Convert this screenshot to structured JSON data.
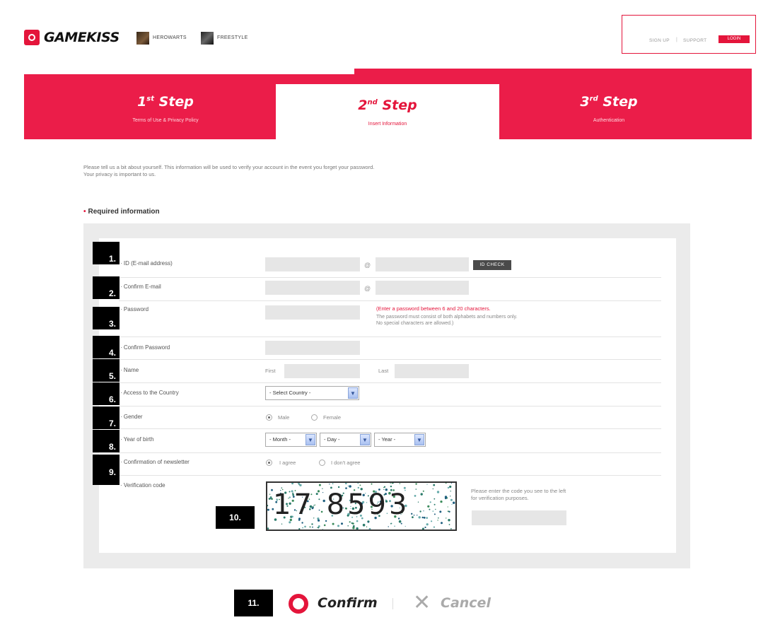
{
  "header": {
    "logo_text": "GAMEKISS",
    "games": [
      "HEROWARTS",
      "FREESTYLE"
    ],
    "links": {
      "signup": "SIGN UP",
      "separator": "|",
      "support": "SUPPORT",
      "login": "LOGIN"
    }
  },
  "steps": [
    {
      "num": "1",
      "suffix": "st",
      "title": "Step",
      "sub": "Terms of Use & Privacy Policy",
      "active": false
    },
    {
      "num": "2",
      "suffix": "nd",
      "title": "Step",
      "sub": "Insert Information",
      "active": true
    },
    {
      "num": "3",
      "suffix": "rd",
      "title": "Step",
      "sub": "Authentication",
      "active": false
    }
  ],
  "intro": {
    "line1": "Please tell us a bit about yourself. This information will be used to verify your account in the event you forget your password.",
    "line2": "Your privacy is important to us."
  },
  "required_title": "Required information",
  "form": {
    "id_label": "· ID (E-mail address)",
    "confirm_email_label": "· Confirm E-mail",
    "password_label": "· Password",
    "confirm_password_label": "· Confirm Password",
    "name_label": "· Name",
    "country_label": "· Access to the Country",
    "gender_label": "· Gender",
    "birth_label": "· Year of birth",
    "newsletter_label": "· Confirmation of newsletter",
    "verification_label": "· Verification code",
    "at_sign": "@",
    "id_check": "ID CHECK",
    "password_hint_red": "(Enter a password between 6 and 20 characters.",
    "password_hint_grey1": "The password must consist of both alphabets and numbers only.",
    "password_hint_grey2": "No special characters are allowed.)",
    "first": "First",
    "last": "Last",
    "country_select": "- Select Country -",
    "male": "Male",
    "female": "Female",
    "month": "- Month -",
    "day": "- Day -",
    "year": "- Year -",
    "agree": "I agree",
    "disagree": "I don't agree",
    "captcha_text": "17 8593",
    "captcha_hint1": "Please enter the code you see to the left",
    "captcha_hint2": "for verification purposes."
  },
  "annotations": [
    "1.",
    "2.",
    "3.",
    "4.",
    "5.",
    "6.",
    "7.",
    "8.",
    "9.",
    "10.",
    "11."
  ],
  "buttons": {
    "confirm": "Confirm",
    "cancel": "Cancel"
  },
  "colors": {
    "brand_red": "#e4153b",
    "step_band": "#eb1d49"
  }
}
